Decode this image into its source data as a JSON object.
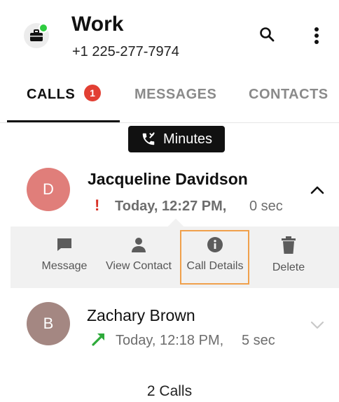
{
  "header": {
    "account_name": "Work",
    "phone": "+1 225-277-7974",
    "icons": {
      "account": "briefcase-icon",
      "search": "search-icon",
      "menu": "more-vert-icon"
    },
    "status_color": "#2ecc40"
  },
  "tabs": [
    {
      "label": "CALLS",
      "badge": "1",
      "active": true
    },
    {
      "label": "MESSAGES",
      "active": false
    },
    {
      "label": "CONTACTS",
      "active": false
    }
  ],
  "minutes_pill": {
    "label": "Minutes",
    "icon": "call-minutes-icon"
  },
  "calls": [
    {
      "initial": "D",
      "name": "Jacqueline Davidson",
      "status_mark": "!",
      "time": "Today, 12:27 PM,",
      "duration": "0 sec",
      "type": "missed",
      "expanded": true,
      "avatar_color": "#e07e7a"
    },
    {
      "initial": "B",
      "name": "Zachary Brown",
      "time": "Today, 12:18 PM,",
      "duration": "5 sec",
      "type": "outgoing",
      "expanded": false,
      "avatar_color": "#a48782"
    }
  ],
  "actions": [
    {
      "label": "Message",
      "icon": "message-icon"
    },
    {
      "label": "View Contact",
      "icon": "person-icon"
    },
    {
      "label": "Call Details",
      "icon": "info-icon",
      "highlighted": true
    },
    {
      "label": "Delete",
      "icon": "trash-icon"
    }
  ],
  "footer": {
    "count_label": "2 Calls"
  },
  "colors": {
    "badge": "#e23f33",
    "missed": "#d83227",
    "outgoing": "#2eaa3a",
    "highlight": "#f0a04b"
  }
}
